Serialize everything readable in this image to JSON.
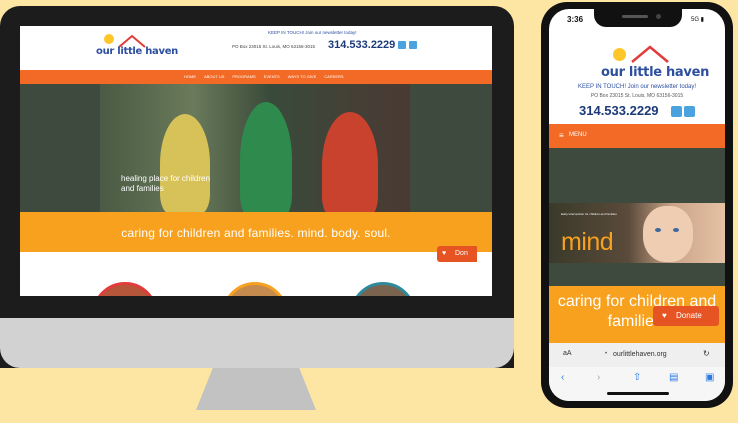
{
  "desktop": {
    "logo_text": "our little haven",
    "newsletter": "KEEP IN TOUCH! Join our newsletter today!",
    "address": "PO Box 23015 St. Louis, MO 63156-3015",
    "phone": "314.533.2229",
    "nav": [
      "HOME",
      "ABOUT US",
      "PROGRAMS",
      "EVENTS",
      "WAYS TO GIVE",
      "CAREERS"
    ],
    "hero_caption": "healing place for children and families",
    "banner": "caring for children and families. mind. body. soul.",
    "donate": "Don"
  },
  "mobile": {
    "time": "3:36",
    "status": "5G",
    "logo_text": "our little haven",
    "newsletter": "KEEP IN TOUCH! Join our newsletter today!",
    "address": "PO Box 23015 St. Louis, MO 63156-3015",
    "phone": "314.533.2229",
    "menu": "MENU",
    "hero_small_text": "Early intervention for children and families",
    "hero_word": "mind",
    "banner": "caring for children and families.",
    "donate": "Donate",
    "text_size": "aA",
    "url": "ourlittlehaven.org",
    "toolbar": [
      "back",
      "forward",
      "share",
      "bookmarks",
      "tabs"
    ]
  },
  "colors": {
    "background": "#fde5a3",
    "nav_orange": "#f26a25",
    "banner_orange": "#f7a11e",
    "brand_blue": "#2d4fa0",
    "donate": "#e65424"
  }
}
